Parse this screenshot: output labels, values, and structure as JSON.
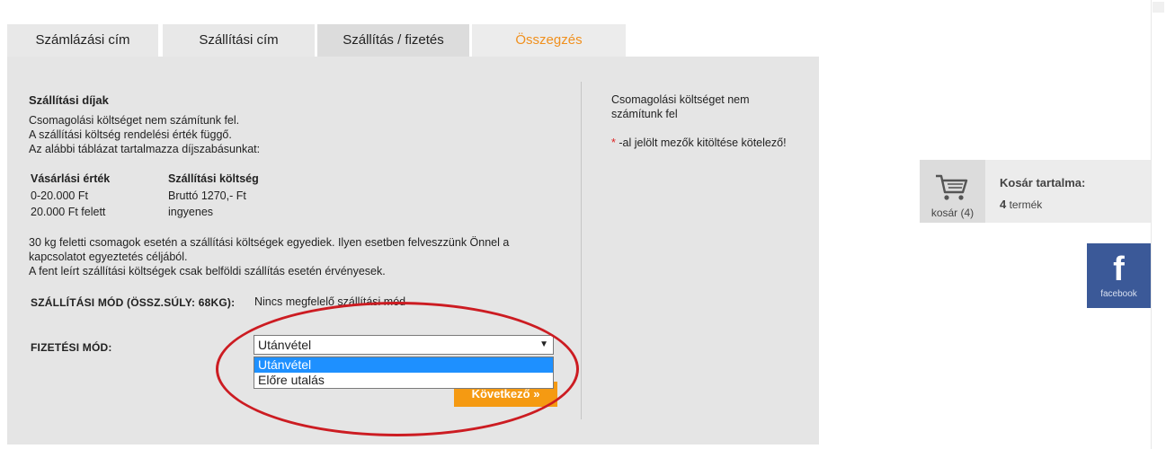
{
  "tabs": [
    {
      "label": "Számlázási cím"
    },
    {
      "label": "Szállítási cím"
    },
    {
      "label": "Szállítás / fizetés"
    },
    {
      "label": "Összegzés"
    }
  ],
  "fees": {
    "title": "Szállítási díjak",
    "lines": [
      "Csomagolási költséget nem számítunk fel.",
      "A szállítási költség rendelési érték függő.",
      "Az alábbi táblázat tartalmazza díjszabásunkat:"
    ],
    "table": {
      "headers": [
        "Vásárlási érték",
        "Szállítási költség"
      ],
      "rows": [
        [
          "0-20.000 Ft",
          "Bruttó 1270,- Ft"
        ],
        [
          "20.000 Ft felett",
          "ingyenes"
        ]
      ]
    },
    "notes": [
      "30 kg feletti csomagok esetén a szállítási költségek egyediek. Ilyen esetben felveszzünk Önnel a kapcsolatot egyeztetés céljából.",
      "A fent leírt szállítási költségek csak belföldi szállítás esetén érvényesek."
    ]
  },
  "shipping": {
    "label": "SZÁLLÍTÁSI MÓD (ÖSSZ.SÚLY: 68KG):",
    "value": "Nincs megfelelő szállítási mód"
  },
  "payment": {
    "label": "FIZETÉSI MÓD:",
    "selected": "Utánvétel",
    "options": [
      "Utánvétel",
      "Előre utalás"
    ]
  },
  "next_button": "Következő »",
  "sidebar_note": {
    "packaging": "Csomagolási költséget nem számítunk fel",
    "asterisk": "*",
    "required": " -al jelölt mezők kitöltése kötelező!"
  },
  "cart": {
    "count_label": "kosár (4)",
    "title": "Kosár tartalma:",
    "item_count": "4",
    "item_unit": " termék"
  },
  "facebook": {
    "glyph": "f",
    "label": "facebook"
  },
  "colors": {
    "accent": "#f59a12",
    "summary_tab": "#f0901e",
    "facebook": "#3b5998",
    "annotation": "#cc1c22",
    "selected_option": "#1e90ff"
  }
}
